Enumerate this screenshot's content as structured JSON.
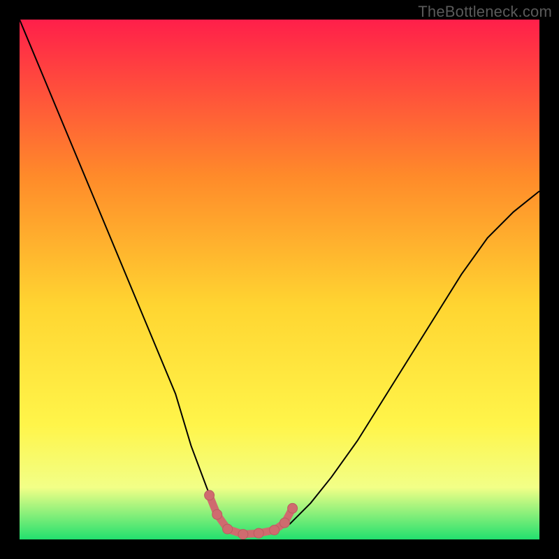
{
  "watermark": "TheBottleneck.com",
  "colors": {
    "frame": "#000000",
    "curve": "#000000",
    "marker": "#cf6b6f",
    "marker_stroke": "#bb5c60",
    "gradient_top": "#ff1f4a",
    "gradient_mid1": "#ff8a2a",
    "gradient_mid2": "#ffd531",
    "gradient_mid3": "#fff54a",
    "gradient_mid4": "#f2ff87",
    "gradient_bottom": "#22e06e"
  },
  "chart_data": {
    "type": "line",
    "title": "",
    "xlabel": "",
    "ylabel": "",
    "xlim": [
      0,
      100
    ],
    "ylim": [
      0,
      100
    ],
    "series": [
      {
        "name": "bottleneck-curve",
        "x": [
          0,
          5,
          10,
          15,
          20,
          25,
          30,
          33,
          36,
          38,
          40,
          42,
          44,
          48,
          52,
          56,
          60,
          65,
          70,
          75,
          80,
          85,
          90,
          95,
          100
        ],
        "y": [
          100,
          88,
          76,
          64,
          52,
          40,
          28,
          18,
          10,
          5,
          2,
          1,
          1,
          1,
          3,
          7,
          12,
          19,
          27,
          35,
          43,
          51,
          58,
          63,
          67
        ]
      }
    ],
    "markers": {
      "name": "optimal-zone",
      "x": [
        36.5,
        38,
        40,
        43,
        46,
        49,
        51,
        52.5
      ],
      "y": [
        8.5,
        4.8,
        2.0,
        1.0,
        1.2,
        1.8,
        3.2,
        6.0
      ]
    }
  }
}
